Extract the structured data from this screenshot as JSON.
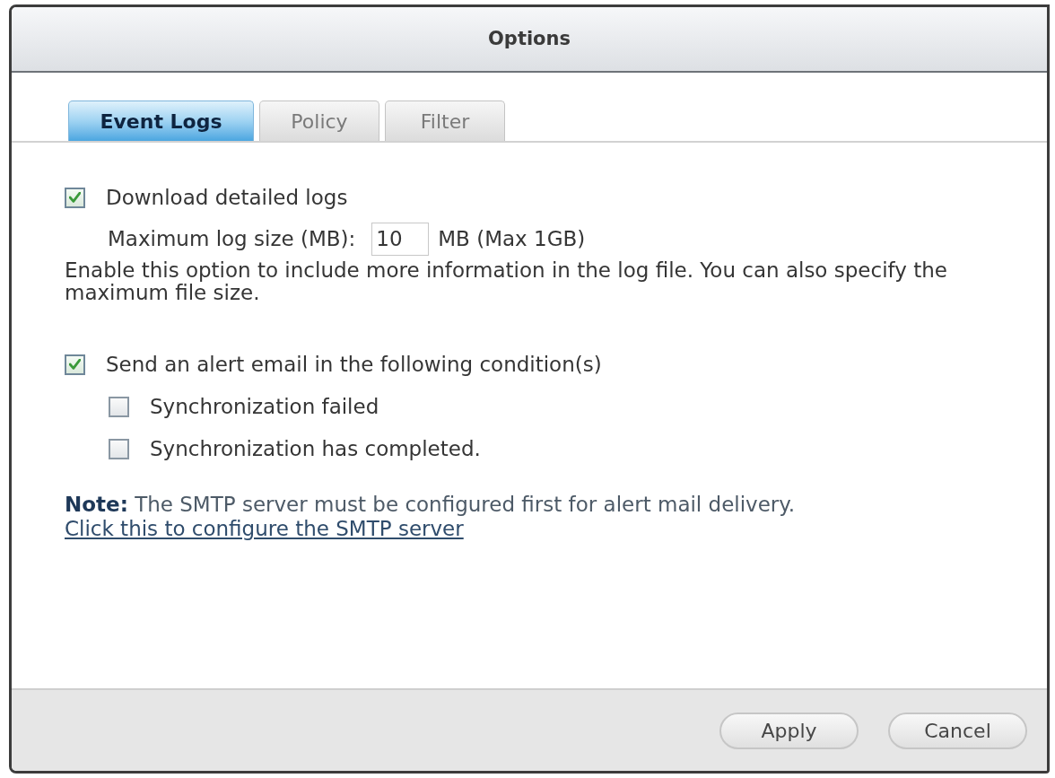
{
  "window": {
    "title": "Options"
  },
  "tabs": [
    {
      "label": "Event Logs",
      "selected": true
    },
    {
      "label": "Policy",
      "selected": false
    },
    {
      "label": "Filter",
      "selected": false
    }
  ],
  "detailed_logs": {
    "label": "Download detailed logs",
    "checked": true,
    "max_size_label": "Maximum log size (MB):",
    "max_size_value": "10",
    "max_size_unit": "MB (Max 1GB)",
    "description": "Enable this option to include more information in the log file. You can also specify the maximum file size."
  },
  "alert_email": {
    "label": "Send an alert email in the following condition(s)",
    "checked": true,
    "conditions": [
      {
        "label": "Synchronization failed",
        "checked": false
      },
      {
        "label": "Synchronization has completed.",
        "checked": false
      }
    ]
  },
  "note": "**Note:** The SMTP server must be configured first for alert mail delivery.",
  "link": "Click this to configure the SMTP server",
  "buttons": [
    "Apply",
    "Cancel"
  ]
}
